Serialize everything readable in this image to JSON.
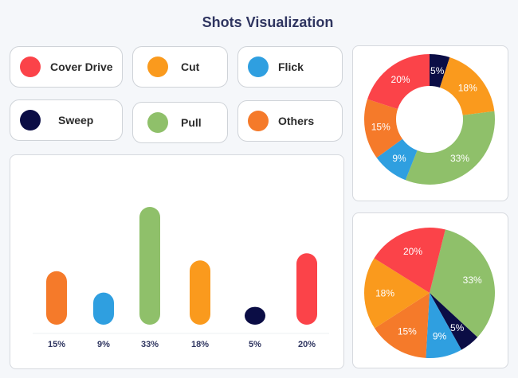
{
  "header": {
    "title": "Shots Visualization"
  },
  "legend": [
    {
      "label": "Cover Drive",
      "color": "#fb4349"
    },
    {
      "label": "Cut",
      "color": "#fa9a1d"
    },
    {
      "label": "Flick",
      "color": "#2f9fe0"
    },
    {
      "label": "Sweep",
      "color": "#0b0d45"
    },
    {
      "label": "Pull",
      "color": "#8fc06a"
    },
    {
      "label": "Others",
      "color": "#f57a2a"
    }
  ],
  "chart_data": [
    {
      "type": "bar",
      "categories": [
        "Others",
        "Flick",
        "Pull",
        "Cut",
        "Sweep",
        "Cover Drive"
      ],
      "values": [
        15,
        9,
        33,
        18,
        5,
        20
      ],
      "tick_labels": [
        "15%",
        "9%",
        "33%",
        "18%",
        "5%",
        "20%"
      ],
      "colors": [
        "#f57a2a",
        "#2f9fe0",
        "#8fc06a",
        "#fa9a1d",
        "#0b0d45",
        "#fb4349"
      ]
    },
    {
      "type": "pie",
      "variant": "donut",
      "slices": [
        {
          "name": "Sweep",
          "value": 5,
          "label": "5%",
          "color": "#0b0d45"
        },
        {
          "name": "Cut",
          "value": 18,
          "label": "18%",
          "color": "#fa9a1d"
        },
        {
          "name": "Pull",
          "value": 33,
          "label": "33%",
          "color": "#8fc06a"
        },
        {
          "name": "Flick",
          "value": 9,
          "label": "9%",
          "color": "#2f9fe0"
        },
        {
          "name": "Others",
          "value": 15,
          "label": "15%",
          "color": "#f57a2a"
        },
        {
          "name": "Cover Drive",
          "value": 20,
          "label": "20%",
          "color": "#fb4349"
        }
      ]
    },
    {
      "type": "pie",
      "slices": [
        {
          "name": "Pull",
          "value": 33,
          "label": "33%",
          "color": "#8fc06a"
        },
        {
          "name": "Sweep",
          "value": 5,
          "label": "5%",
          "color": "#0b0d45"
        },
        {
          "name": "Flick",
          "value": 9,
          "label": "9%",
          "color": "#2f9fe0"
        },
        {
          "name": "Others",
          "value": 15,
          "label": "15%",
          "color": "#f57a2a"
        },
        {
          "name": "Cut",
          "value": 18,
          "label": "18%",
          "color": "#fa9a1d"
        },
        {
          "name": "Cover Drive",
          "value": 20,
          "label": "20%",
          "color": "#fb4349"
        }
      ]
    }
  ]
}
